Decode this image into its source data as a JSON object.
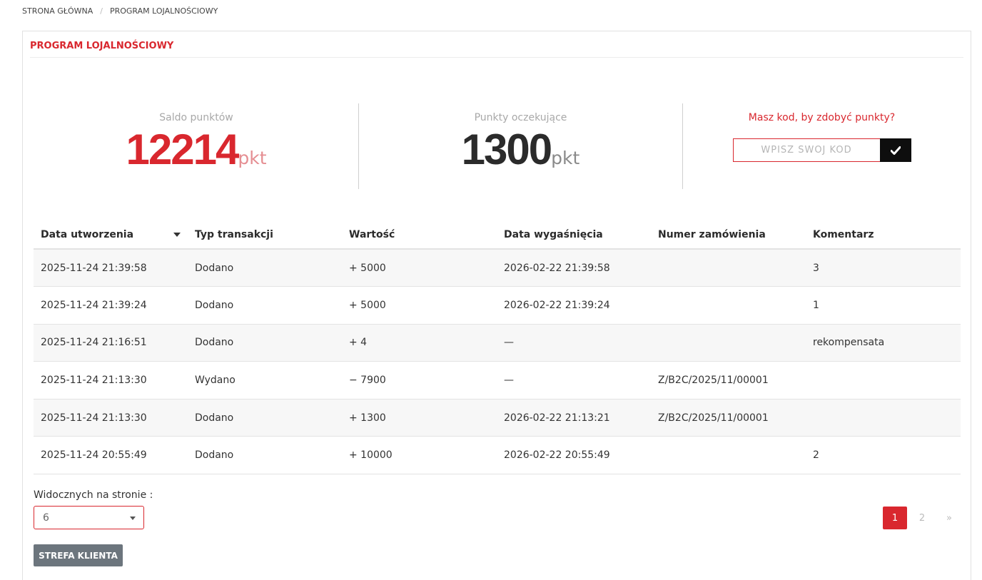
{
  "breadcrumb": {
    "home": "STRONA GŁÓWNA",
    "separator": "/",
    "current": "PROGRAM LOJALNOŚCIOWY"
  },
  "panel": {
    "title": "PROGRAM LOJALNOŚCIOWY"
  },
  "stats": {
    "balance": {
      "label": "Saldo punktów",
      "value": "12214",
      "unit": "pkt"
    },
    "pending": {
      "label": "Punkty oczekujące",
      "value": "1300",
      "unit": "pkt"
    },
    "promo": {
      "label": "Masz kod, by zdobyć punkty?",
      "placeholder": "WPISZ SWÓJ KOD",
      "submit_icon": "check-icon"
    }
  },
  "table": {
    "columns": [
      "Data utworzenia",
      "Typ transakcji",
      "Wartość",
      "Data wygaśnięcia",
      "Numer zamówienia",
      "Komentarz"
    ],
    "sorted_column": "Data utworzenia",
    "rows": [
      {
        "created": "2025-11-24 21:39:58",
        "type": "Dodano",
        "value": "+ 5000",
        "sign": "plus",
        "expires": "2026-02-22 21:39:58",
        "order": "",
        "comment": "3"
      },
      {
        "created": "2025-11-24 21:39:24",
        "type": "Dodano",
        "value": "+ 5000",
        "sign": "plus",
        "expires": "2026-02-22 21:39:24",
        "order": "",
        "comment": "1"
      },
      {
        "created": "2025-11-24 21:16:51",
        "type": "Dodano",
        "value": "+ 4",
        "sign": "plus",
        "expires": "—",
        "order": "",
        "comment": "rekompensata"
      },
      {
        "created": "2025-11-24 21:13:30",
        "type": "Wydano",
        "value": "− 7900",
        "sign": "minus",
        "expires": "—",
        "order": "Z/B2C/2025/11/00001",
        "comment": ""
      },
      {
        "created": "2025-11-24 21:13:30",
        "type": "Dodano",
        "value": "+ 1300",
        "sign": "plus",
        "expires": "2026-02-22 21:13:21",
        "order": "Z/B2C/2025/11/00001",
        "comment": ""
      },
      {
        "created": "2025-11-24 20:55:49",
        "type": "Dodano",
        "value": "+ 10000",
        "sign": "plus",
        "expires": "2026-02-22 20:55:49",
        "order": "",
        "comment": "2"
      }
    ]
  },
  "per_page": {
    "label": "Widocznych na stronie :",
    "selected": "6"
  },
  "pagination": {
    "pages": [
      "1",
      "2"
    ],
    "current": "1",
    "next": "»"
  },
  "back_button": "STREFA KLIENTA",
  "colors": {
    "accent": "#d9272e",
    "positive": "#1b7a6e",
    "negative": "#d9272e",
    "button_grey": "#6c757d"
  }
}
